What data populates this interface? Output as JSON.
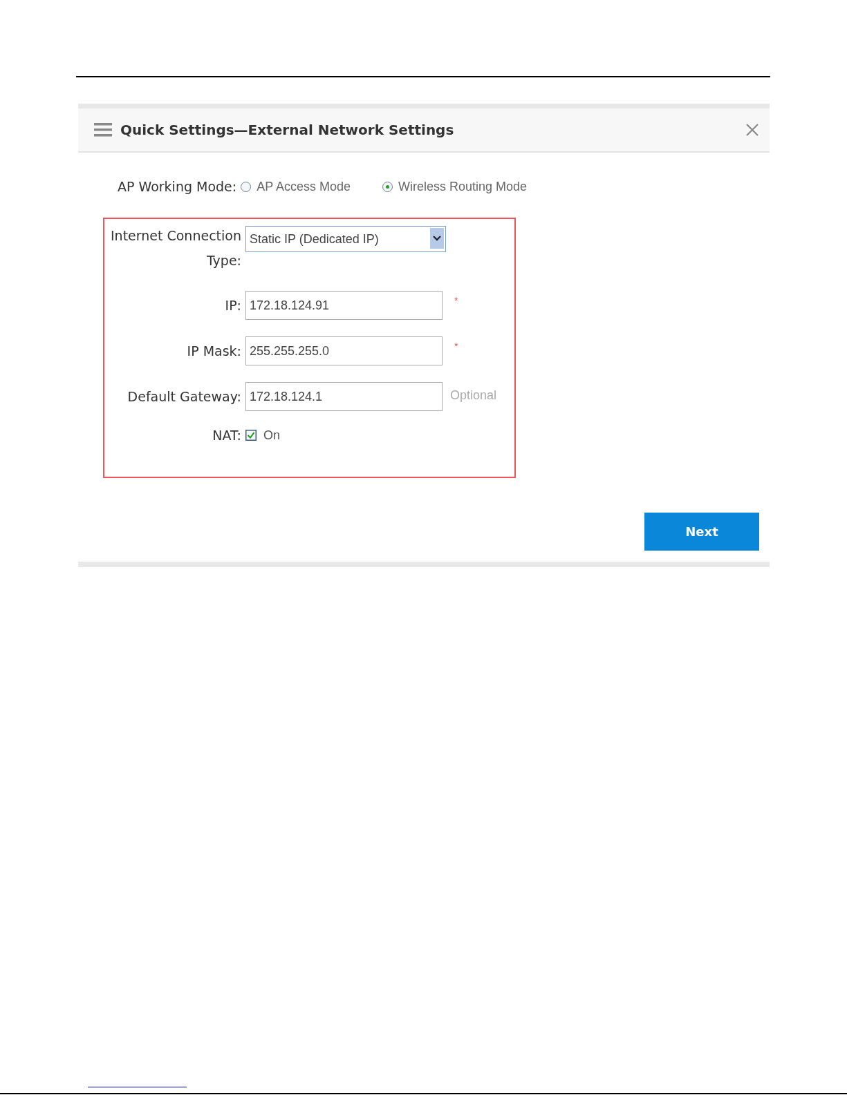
{
  "dialog": {
    "title": "Quick Settings—External Network Settings"
  },
  "working_mode": {
    "label": "AP Working Mode:",
    "options": [
      {
        "label": "AP Access Mode",
        "selected": false
      },
      {
        "label": "Wireless Routing Mode",
        "selected": true
      }
    ]
  },
  "form": {
    "connection_type": {
      "label": "Internet Connection Type:",
      "value": "Static IP (Dedicated IP)"
    },
    "fields": [
      {
        "label": "IP:",
        "value": "172.18.124.91",
        "note": "*",
        "kind": "required"
      },
      {
        "label": "IP Mask:",
        "value": "255.255.255.0",
        "note": "*",
        "kind": "required"
      },
      {
        "label": "Default Gateway:",
        "value": "172.18.124.1",
        "note": "Optional",
        "kind": "optional"
      }
    ],
    "nat": {
      "label": "NAT:",
      "option": "On",
      "checked": true
    }
  },
  "buttons": [
    {
      "label": "Next"
    }
  ]
}
